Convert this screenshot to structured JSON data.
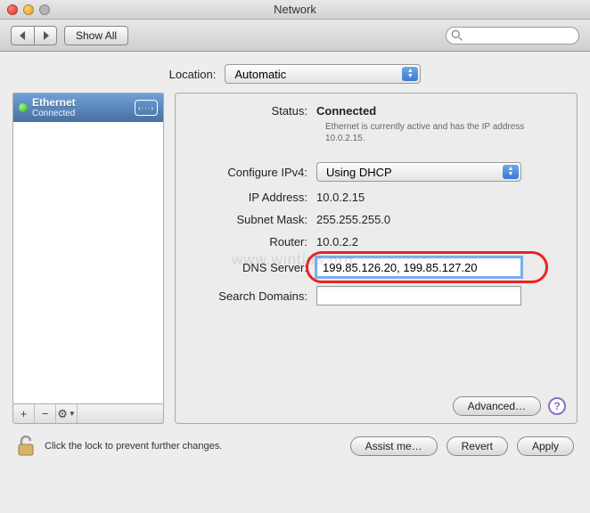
{
  "window": {
    "title": "Network"
  },
  "toolbar": {
    "show_all_label": "Show All",
    "search_placeholder": ""
  },
  "location": {
    "label": "Location:",
    "value": "Automatic"
  },
  "sidebar": {
    "connections": [
      {
        "name": "Ethernet",
        "status": "Connected"
      }
    ],
    "add": "+",
    "remove": "−",
    "gear": "⚙"
  },
  "detail": {
    "status_label": "Status:",
    "status_value": "Connected",
    "status_sub": "Ethernet is currently active and has the IP address 10.0.2.15.",
    "configure_label": "Configure IPv4:",
    "configure_value": "Using DHCP",
    "ip_label": "IP Address:",
    "ip_value": "10.0.2.15",
    "subnet_label": "Subnet Mask:",
    "subnet_value": "255.255.255.0",
    "router_label": "Router:",
    "router_value": "10.0.2.2",
    "dns_label": "DNS Server:",
    "dns_value": "199.85.126.20, 199.85.127.20",
    "search_label": "Search Domains:",
    "search_value": "",
    "advanced_label": "Advanced…"
  },
  "footer": {
    "lock_text": "Click the lock to prevent further changes.",
    "assist_label": "Assist me…",
    "revert_label": "Revert",
    "apply_label": "Apply"
  },
  "watermark": "www.wintips.org"
}
